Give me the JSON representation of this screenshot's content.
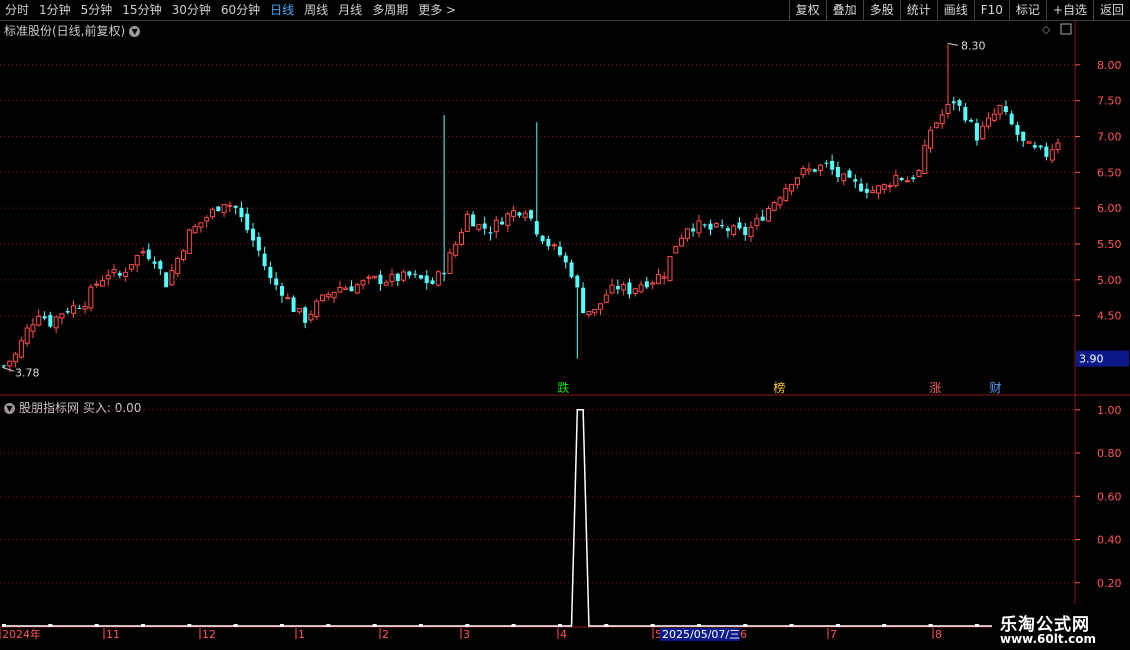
{
  "toolbar": {
    "periods": [
      "分时",
      "1分钟",
      "5分钟",
      "15分钟",
      "30分钟",
      "60分钟",
      "日线",
      "周线",
      "月线",
      "多周期",
      "更多 >"
    ],
    "active_period": "日线",
    "actions": [
      "复权",
      "叠加",
      "多股",
      "统计",
      "画线",
      "F10",
      "标记",
      "+自选",
      "返回"
    ]
  },
  "colors": {
    "up": "#ff4d4d",
    "down": "#54ffff",
    "grid": "#8a1a1a",
    "axis_text": "#ff5555",
    "indicator_line": "#ffffff",
    "signal_die": "#00e000",
    "signal_bang": "#ffcc33",
    "signal_zhang": "#ff6060",
    "signal_cai": "#5aa0ff"
  },
  "chart_data": [
    {
      "type": "candlestick",
      "title": "标准股份(日线,前复权)",
      "ylim": [
        3.7,
        8.5
      ],
      "yticks": [
        4.5,
        5.0,
        5.5,
        6.0,
        6.5,
        7.0,
        7.5,
        8.0
      ],
      "current_price_label": "3.90",
      "max_label": "8.30",
      "min_label": "3.78",
      "x_labels": [
        "2024年",
        "11",
        "12",
        "1",
        "2",
        "3",
        "4",
        "5",
        "6",
        "7",
        "8"
      ],
      "cursor_date": "2025/05/07/三",
      "signals": [
        {
          "text": "跌",
          "x": 0.525,
          "color": "signal_die"
        },
        {
          "text": "榜",
          "x": 0.73,
          "color": "signal_bang"
        },
        {
          "text": "涨",
          "x": 0.878,
          "color": "signal_zhang"
        },
        {
          "text": "财",
          "x": 0.935,
          "color": "signal_cai"
        }
      ],
      "anchors": [
        [
          0,
          3.8
        ],
        [
          2,
          3.95
        ],
        [
          4,
          4.3
        ],
        [
          6,
          4.55
        ],
        [
          8,
          4.4
        ],
        [
          10,
          4.55
        ],
        [
          12,
          4.62
        ],
        [
          14,
          4.7
        ],
        [
          16,
          4.95
        ],
        [
          18,
          5.1
        ],
        [
          20,
          5.05
        ],
        [
          22,
          5.25
        ],
        [
          24,
          5.4
        ],
        [
          26,
          5.3
        ],
        [
          28,
          4.95
        ],
        [
          30,
          5.3
        ],
        [
          32,
          5.65
        ],
        [
          34,
          5.8
        ],
        [
          36,
          5.95
        ],
        [
          38,
          6.1
        ],
        [
          40,
          6.0
        ],
        [
          42,
          5.7
        ],
        [
          44,
          5.4
        ],
        [
          46,
          5.0
        ],
        [
          48,
          4.85
        ],
        [
          50,
          4.6
        ],
        [
          52,
          4.45
        ],
        [
          54,
          4.65
        ],
        [
          56,
          4.8
        ],
        [
          58,
          4.9
        ],
        [
          60,
          4.9
        ],
        [
          62,
          4.95
        ],
        [
          64,
          5.0
        ],
        [
          66,
          5.0
        ],
        [
          68,
          5.02
        ],
        [
          70,
          5.05
        ],
        [
          72,
          5.0
        ],
        [
          74,
          4.95
        ],
        [
          76,
          5.15
        ],
        [
          78,
          5.5
        ],
        [
          80,
          5.9
        ],
        [
          82,
          5.75
        ],
        [
          84,
          5.7
        ],
        [
          86,
          5.85
        ],
        [
          88,
          5.95
        ],
        [
          90,
          6.0
        ],
        [
          92,
          5.7
        ],
        [
          94,
          5.5
        ],
        [
          96,
          5.35
        ],
        [
          98,
          5.1
        ],
        [
          100,
          4.6
        ],
        [
          102,
          4.55
        ],
        [
          104,
          4.8
        ],
        [
          106,
          4.9
        ],
        [
          108,
          4.85
        ],
        [
          110,
          4.95
        ],
        [
          112,
          5.0
        ],
        [
          114,
          5.1
        ],
        [
          116,
          5.5
        ],
        [
          118,
          5.75
        ],
        [
          120,
          5.75
        ],
        [
          122,
          5.7
        ],
        [
          124,
          5.72
        ],
        [
          126,
          5.68
        ],
        [
          128,
          5.65
        ],
        [
          130,
          5.8
        ],
        [
          132,
          6.0
        ],
        [
          134,
          6.2
        ],
        [
          136,
          6.4
        ],
        [
          138,
          6.5
        ],
        [
          140,
          6.55
        ],
        [
          142,
          6.6
        ],
        [
          144,
          6.45
        ],
        [
          146,
          6.35
        ],
        [
          148,
          6.3
        ],
        [
          150,
          6.25
        ],
        [
          152,
          6.3
        ],
        [
          154,
          6.45
        ],
        [
          156,
          6.4
        ],
        [
          158,
          6.5
        ],
        [
          160,
          7.1
        ],
        [
          162,
          7.3
        ],
        [
          164,
          7.5
        ],
        [
          166,
          7.3
        ],
        [
          168,
          7.0
        ],
        [
          170,
          7.2
        ],
        [
          172,
          7.4
        ],
        [
          174,
          7.15
        ],
        [
          176,
          6.9
        ],
        [
          178,
          6.8
        ],
        [
          180,
          6.75
        ],
        [
          182,
          6.95
        ]
      ]
    },
    {
      "type": "line",
      "title": "股朋指标网",
      "label": "买入:",
      "label_value": "0.00",
      "ylim": [
        0,
        1.05
      ],
      "yticks": [
        0.2,
        0.4,
        0.6,
        0.8,
        1.0
      ],
      "x": [
        0,
        98,
        99,
        100,
        101,
        182
      ],
      "values": [
        0,
        0,
        1.0,
        1.0,
        0,
        0
      ]
    }
  ],
  "watermark": {
    "name": "乐淘公式网",
    "url": "www.60lt.com"
  }
}
